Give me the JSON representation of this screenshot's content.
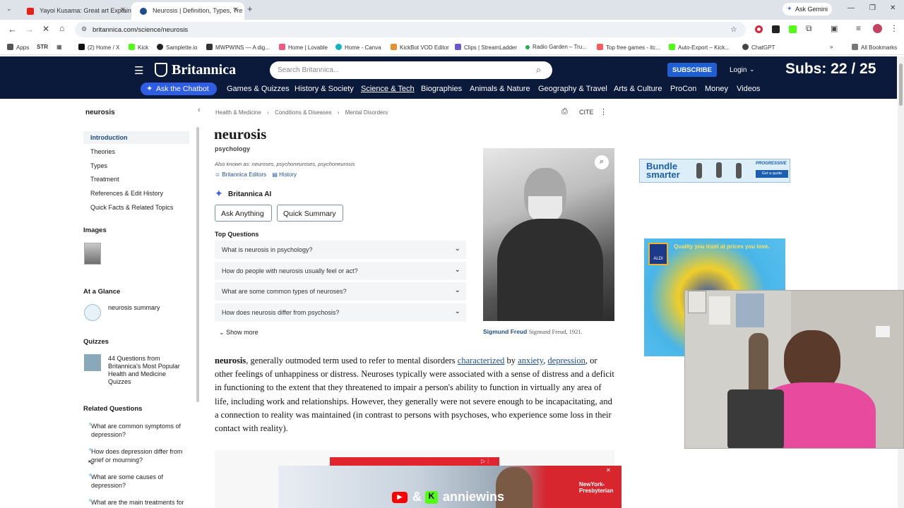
{
  "browser": {
    "tabs": [
      {
        "title": "Yayoi Kusama: Great art Explain",
        "favicon_color": "#e62117"
      },
      {
        "title": "Neurosis | Definition, Types, Tre",
        "favicon_color": "#1d4e89"
      }
    ],
    "new_tab": "+",
    "ask_gemini": "Ask Gemini",
    "url": "britannica.com/science/neurosis",
    "bookmarks": [
      "Apps",
      "STR",
      "(2) Home / X",
      "Kick",
      "Samplette.io",
      "MWPWINS — A dig...",
      "Home | Lovable",
      "Home - Canva",
      "KickBot VOD Editor",
      "Clips | StreamLadder",
      "Radio Garden – Tru...",
      "Top free games - itc...",
      "Auto-Export – Kick...",
      "ChatGPT"
    ],
    "all_bookmarks": "All Bookmarks"
  },
  "header": {
    "logo": "Britannica",
    "search_placeholder": "Search Britannica...",
    "subscribe": "SUBSCRIBE",
    "login": "Login",
    "ask_chatbot": "Ask the Chatbot",
    "nav": [
      "Games & Quizzes",
      "History & Society",
      "Science & Tech",
      "Biographies",
      "Animals & Nature",
      "Geography & Travel",
      "Arts & Culture",
      "ProCon",
      "Money",
      "Videos"
    ]
  },
  "overlay": {
    "subs": "Subs: 22 / 25",
    "stream_brand": "anniewins",
    "stream_amp": "&"
  },
  "sidebar": {
    "title": "neurosis",
    "toc": [
      "Introduction",
      "Theories",
      "Types",
      "Treatment",
      "References & Edit History",
      "Quick Facts & Related Topics"
    ],
    "images_heading": "Images",
    "glance_heading": "At a Glance",
    "glance_item": "neurosis summary",
    "quizzes_heading": "Quizzes",
    "quiz_item": "44 Questions from Britannica's Most Popular Health and Medicine Quizzes",
    "related_heading": "Related Questions",
    "related": [
      "What are common symptoms of depression?",
      "How does depression differ from grief or mourning?",
      "What are some causes of depression?",
      "What are the main treatments for"
    ]
  },
  "breadcrumb": [
    "Health & Medicine",
    "Conditions & Diseases",
    "Mental Disorders"
  ],
  "cite": "CITE",
  "article": {
    "title": "neurosis",
    "subtitle": "psychology",
    "aka": "Also known as: neuroses, psychoneuroses, psychoneurosis",
    "editors": "Britannica Editors",
    "history": "History",
    "ai_label": "Britannica AI",
    "ask_anything": "Ask Anything",
    "quick_summary": "Quick Summary",
    "top_questions": "Top Questions",
    "questions": [
      "What is neurosis in psychology?",
      "How do people with neurosis usually feel or act?",
      "What are some common types of neuroses?",
      "How does neurosis differ from psychosis?"
    ],
    "show_more": "Show more",
    "caption_bold": "Sigmund Freud",
    "caption": "Sigmund Freud, 1921.",
    "p_word": "neurosis",
    "p1": ", generally outmoded term used to refer to mental disorders ",
    "link1": "characterized",
    "p2": " by ",
    "link2": "anxiety",
    "p3": ",",
    "link3": "depression",
    "p4": ", or other feelings of unhappiness or distress. Neuroses typically were associated with a sense of distress and a deficit in functioning to the extent that they threatened to impair a person's ability to function in virtually any area of life, including work and relationships. However, they generally were not severe enough to be incapacitating, and a connection to reality was maintained (in contrast to persons with psychoses, who experience some loss in their contact with reality)."
  },
  "ads": {
    "bundle": "Bundle smarter",
    "progressive": "PROGRESSIVE",
    "get_quote": "Get a quote",
    "aldi": "ALDI",
    "aldi_text": "Quality you trust at prices you love.",
    "nyp": "NewYork-Presbyterian"
  },
  "colors": {
    "brand_navy": "#0b1a3a",
    "subscribe_blue": "#1f5fd1",
    "chatbot_blue": "#2f5ee5",
    "link": "#1d4e89"
  }
}
